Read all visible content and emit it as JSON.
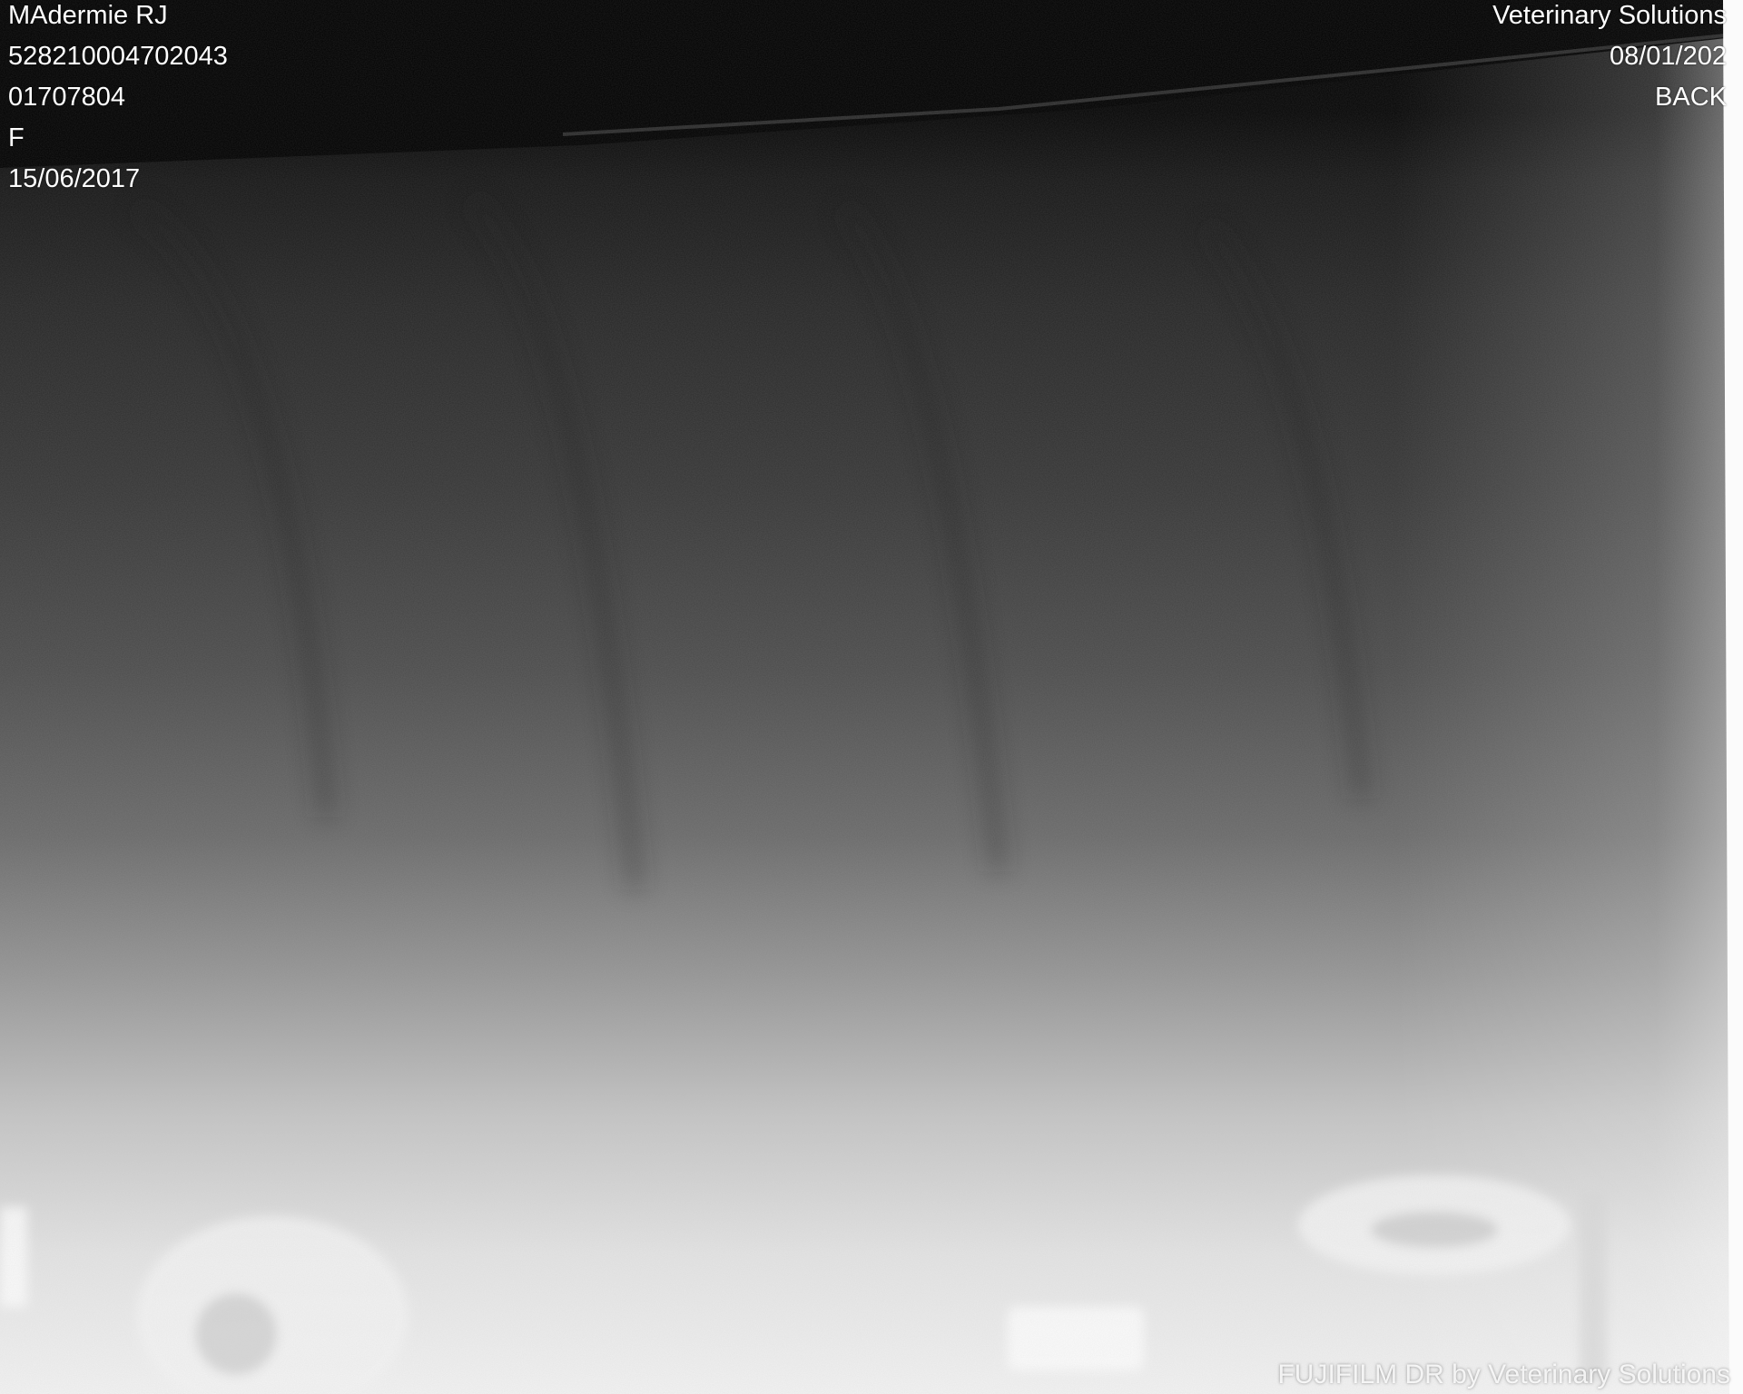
{
  "overlay": {
    "patient_name": "MAdermie RJ",
    "patient_id": "528210004702043",
    "accession": "01707804",
    "sex": "F",
    "birth_date": "15/06/2017",
    "institution": "Veterinary Solutions",
    "study_date": "08/01/202",
    "view": "BACK"
  },
  "footer": {
    "brand": "FUJIFILM DR by Veterinary Solutions"
  },
  "colors": {
    "background": "#000000",
    "text": "#ffffff"
  }
}
